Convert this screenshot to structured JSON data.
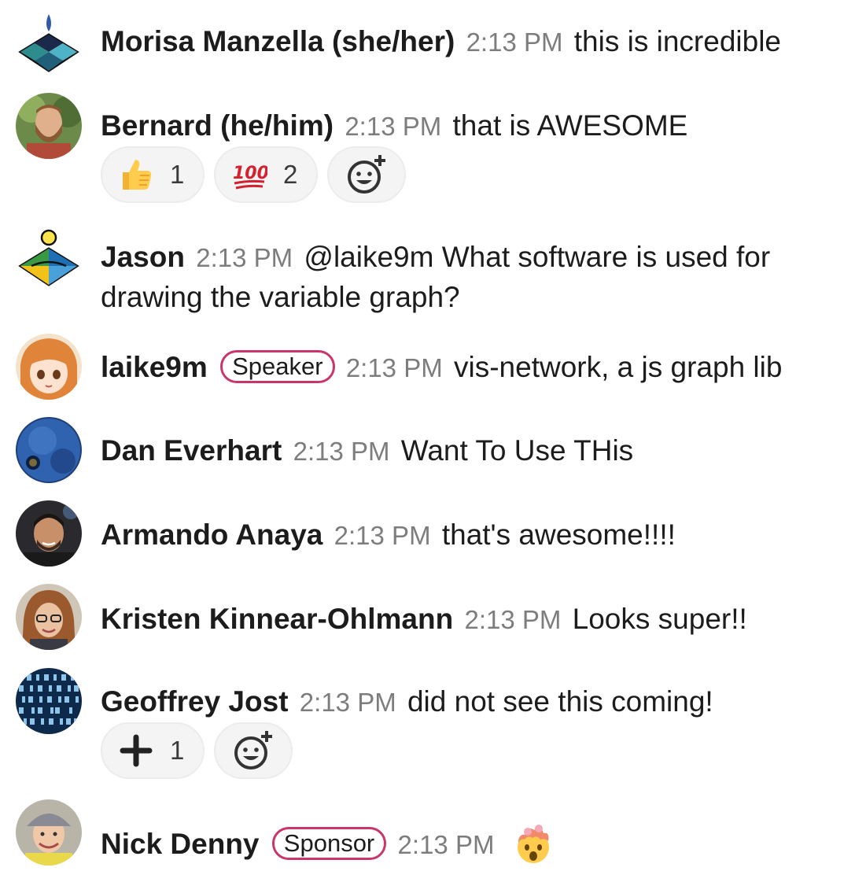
{
  "messages": [
    {
      "name": "Morisa Manzella (she/her)",
      "time": "2:13 PM",
      "text": "this is incredible",
      "avatar_icon": "geometric-diamond-blue-avatar"
    },
    {
      "name": "Bernard (he/him)",
      "time": "2:13 PM",
      "text": "that is AWESOME",
      "avatar_icon": "bearded-man-photo-avatar",
      "reactions": [
        {
          "emoji": "thumbs-up-icon",
          "count": "1"
        },
        {
          "emoji": "hundred-points-icon",
          "count": "2"
        }
      ]
    },
    {
      "name": "Jason",
      "time": "2:13 PM",
      "text": "@laike9m What software is used for drawing the variable graph?",
      "avatar_icon": "geometric-diamond-sun-avatar"
    },
    {
      "name": "laike9m",
      "badge": "Speaker",
      "time": "2:13 PM",
      "text": "vis-network, a js graph lib",
      "avatar_icon": "anime-girl-avatar"
    },
    {
      "name": "Dan Everhart",
      "time": "2:13 PM",
      "text": "Want To Use THis",
      "avatar_icon": "blue-planet-avatar"
    },
    {
      "name": "Armando Anaya",
      "time": "2:13 PM",
      "text": "that's awesome!!!!",
      "avatar_icon": "smiling-man-photo-avatar"
    },
    {
      "name": "Kristen Kinnear-Ohlmann",
      "time": "2:13 PM",
      "text": "Looks super!!",
      "avatar_icon": "woman-glasses-photo-avatar"
    },
    {
      "name": "Geoffrey Jost",
      "time": "2:13 PM",
      "text": "did not see this coming!",
      "avatar_icon": "binary-pattern-avatar",
      "reactions": [
        {
          "emoji": "plus-one-icon",
          "count": "1"
        }
      ]
    },
    {
      "name": "Nick Denny",
      "badge": "Sponsor",
      "time": "2:13 PM",
      "text": "",
      "inline_emoji": "exploding-head-icon",
      "avatar_icon": "man-cap-photo-avatar"
    }
  ],
  "add_reaction_icon": "add-reaction-icon",
  "colors": {
    "badge_border": "#c9366b",
    "timestamp": "#7d7d7d",
    "reaction_bg": "#f4f4f4"
  }
}
